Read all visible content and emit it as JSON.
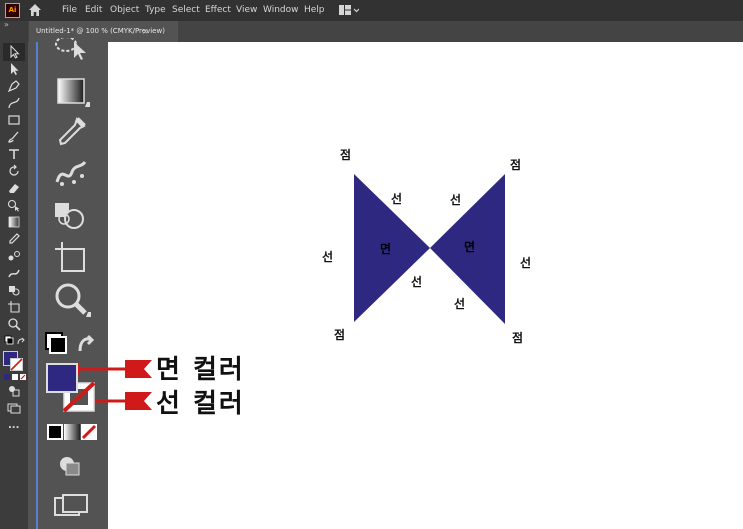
{
  "app": {
    "logo": "Ai"
  },
  "menu": [
    "File",
    "Edit",
    "Object",
    "Type",
    "Select",
    "Effect",
    "View",
    "Window",
    "Help"
  ],
  "document": {
    "tab_title": "Untitled-1* @ 100 % (CMYK/Preview)",
    "close_glyph": "×"
  },
  "toolbar_left": {
    "expand_glyph": "»",
    "tools": [
      "selection-tool-icon",
      "direct-selection-icon",
      "pen-icon",
      "curvature-icon",
      "rectangle-icon",
      "paintbrush-icon",
      "type-icon",
      "rotate-icon",
      "eraser-icon",
      "shape-builder-icon",
      "gradient-icon",
      "eyedropper-icon",
      "blend-icon",
      "symbol-sprayer-icon",
      "artboard-icon",
      "zoom-icon"
    ],
    "more_glyph": "..."
  },
  "toolbar_big": {
    "tools": [
      "lasso-select-icon",
      "gradient-icon",
      "eyedropper-icon",
      "symbol-sprayer-icon",
      "live-paint-icon",
      "artboard-icon",
      "zoom-icon"
    ]
  },
  "colors": {
    "fill": "#2e2880",
    "stroke": "none",
    "stroke_slash": "#d01a1a",
    "arrow": "#d01a1a"
  },
  "artwork": {
    "labels_point": [
      "점",
      "점",
      "점",
      "점"
    ],
    "labels_line": [
      "선",
      "선",
      "선",
      "선",
      "선",
      "선"
    ],
    "labels_face": [
      "면",
      "면"
    ]
  },
  "callouts": {
    "fill_color": "면 컬러",
    "stroke_color": "선 컬러"
  }
}
